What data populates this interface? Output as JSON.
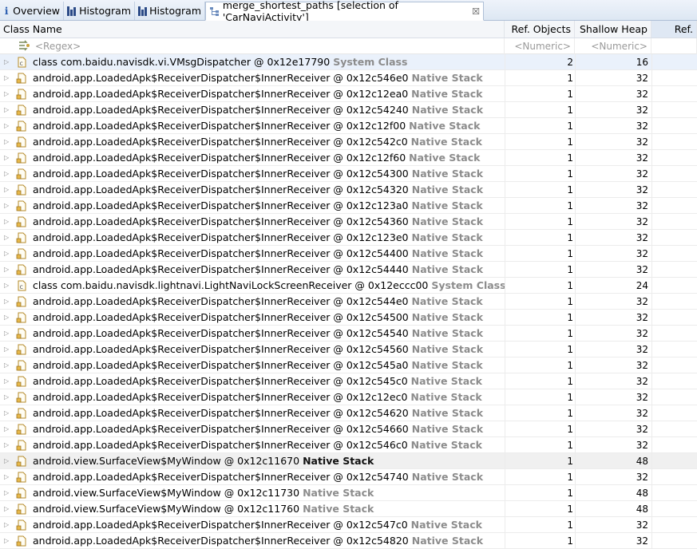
{
  "tabs": [
    {
      "label": "Overview",
      "icon": "info-icon"
    },
    {
      "label": "Histogram",
      "icon": "histogram-icon"
    },
    {
      "label": "Histogram",
      "icon": "histogram-icon"
    },
    {
      "label": "merge_shortest_paths [selection of 'CarNaviActivity']",
      "icon": "tree-icon",
      "active": true,
      "close": "☒"
    }
  ],
  "columns": {
    "class_name": "Class Name",
    "ref_objects": "Ref. Objects",
    "shallow_heap": "Shallow Heap",
    "ref_shallow": "Ref."
  },
  "filters": {
    "regex": "<Regex>",
    "numeric1": "<Numeric>",
    "numeric2": "<Numeric>"
  },
  "rows": [
    {
      "name": "class com.baidu.navisdk.vi.VMsgDispatcher @ 0x12e17790",
      "note": "System Class",
      "ref": "2",
      "shallow": "16",
      "type": "class"
    },
    {
      "name": "android.app.LoadedApk$ReceiverDispatcher$InnerReceiver @ 0x12c546e0",
      "note": "Native Stack",
      "ref": "1",
      "shallow": "32",
      "type": "obj"
    },
    {
      "name": "android.app.LoadedApk$ReceiverDispatcher$InnerReceiver @ 0x12c12ea0",
      "note": "Native Stack",
      "ref": "1",
      "shallow": "32",
      "type": "obj"
    },
    {
      "name": "android.app.LoadedApk$ReceiverDispatcher$InnerReceiver @ 0x12c54240",
      "note": "Native Stack",
      "ref": "1",
      "shallow": "32",
      "type": "obj"
    },
    {
      "name": "android.app.LoadedApk$ReceiverDispatcher$InnerReceiver @ 0x12c12f00",
      "note": "Native Stack",
      "ref": "1",
      "shallow": "32",
      "type": "obj"
    },
    {
      "name": "android.app.LoadedApk$ReceiverDispatcher$InnerReceiver @ 0x12c542c0",
      "note": "Native Stack",
      "ref": "1",
      "shallow": "32",
      "type": "obj"
    },
    {
      "name": "android.app.LoadedApk$ReceiverDispatcher$InnerReceiver @ 0x12c12f60",
      "note": "Native Stack",
      "ref": "1",
      "shallow": "32",
      "type": "obj"
    },
    {
      "name": "android.app.LoadedApk$ReceiverDispatcher$InnerReceiver @ 0x12c54300",
      "note": "Native Stack",
      "ref": "1",
      "shallow": "32",
      "type": "obj"
    },
    {
      "name": "android.app.LoadedApk$ReceiverDispatcher$InnerReceiver @ 0x12c54320",
      "note": "Native Stack",
      "ref": "1",
      "shallow": "32",
      "type": "obj"
    },
    {
      "name": "android.app.LoadedApk$ReceiverDispatcher$InnerReceiver @ 0x12c123a0",
      "note": "Native Stack",
      "ref": "1",
      "shallow": "32",
      "type": "obj"
    },
    {
      "name": "android.app.LoadedApk$ReceiverDispatcher$InnerReceiver @ 0x12c54360",
      "note": "Native Stack",
      "ref": "1",
      "shallow": "32",
      "type": "obj"
    },
    {
      "name": "android.app.LoadedApk$ReceiverDispatcher$InnerReceiver @ 0x12c123e0",
      "note": "Native Stack",
      "ref": "1",
      "shallow": "32",
      "type": "obj"
    },
    {
      "name": "android.app.LoadedApk$ReceiverDispatcher$InnerReceiver @ 0x12c54400",
      "note": "Native Stack",
      "ref": "1",
      "shallow": "32",
      "type": "obj"
    },
    {
      "name": "android.app.LoadedApk$ReceiverDispatcher$InnerReceiver @ 0x12c54440",
      "note": "Native Stack",
      "ref": "1",
      "shallow": "32",
      "type": "obj"
    },
    {
      "name": "class com.baidu.navisdk.lightnavi.LightNaviLockScreenReceiver @ 0x12eccc00",
      "note": "System Class",
      "ref": "1",
      "shallow": "24",
      "type": "class"
    },
    {
      "name": "android.app.LoadedApk$ReceiverDispatcher$InnerReceiver @ 0x12c544e0",
      "note": "Native Stack",
      "ref": "1",
      "shallow": "32",
      "type": "obj"
    },
    {
      "name": "android.app.LoadedApk$ReceiverDispatcher$InnerReceiver @ 0x12c54500",
      "note": "Native Stack",
      "ref": "1",
      "shallow": "32",
      "type": "obj"
    },
    {
      "name": "android.app.LoadedApk$ReceiverDispatcher$InnerReceiver @ 0x12c54540",
      "note": "Native Stack",
      "ref": "1",
      "shallow": "32",
      "type": "obj"
    },
    {
      "name": "android.app.LoadedApk$ReceiverDispatcher$InnerReceiver @ 0x12c54560",
      "note": "Native Stack",
      "ref": "1",
      "shallow": "32",
      "type": "obj"
    },
    {
      "name": "android.app.LoadedApk$ReceiverDispatcher$InnerReceiver @ 0x12c545a0",
      "note": "Native Stack",
      "ref": "1",
      "shallow": "32",
      "type": "obj"
    },
    {
      "name": "android.app.LoadedApk$ReceiverDispatcher$InnerReceiver @ 0x12c545c0",
      "note": "Native Stack",
      "ref": "1",
      "shallow": "32",
      "type": "obj"
    },
    {
      "name": "android.app.LoadedApk$ReceiverDispatcher$InnerReceiver @ 0x12c12ec0",
      "note": "Native Stack",
      "ref": "1",
      "shallow": "32",
      "type": "obj"
    },
    {
      "name": "android.app.LoadedApk$ReceiverDispatcher$InnerReceiver @ 0x12c54620",
      "note": "Native Stack",
      "ref": "1",
      "shallow": "32",
      "type": "obj"
    },
    {
      "name": "android.app.LoadedApk$ReceiverDispatcher$InnerReceiver @ 0x12c54660",
      "note": "Native Stack",
      "ref": "1",
      "shallow": "32",
      "type": "obj"
    },
    {
      "name": "android.app.LoadedApk$ReceiverDispatcher$InnerReceiver @ 0x12c546c0",
      "note": "Native Stack",
      "ref": "1",
      "shallow": "32",
      "type": "obj"
    },
    {
      "name": "android.view.SurfaceView$MyWindow @ 0x12c11670",
      "note": "Native Stack",
      "ref": "1",
      "shallow": "48",
      "type": "obj",
      "strong": true
    },
    {
      "name": "android.app.LoadedApk$ReceiverDispatcher$InnerReceiver @ 0x12c54740",
      "note": "Native Stack",
      "ref": "1",
      "shallow": "32",
      "type": "obj"
    },
    {
      "name": "android.view.SurfaceView$MyWindow @ 0x12c11730",
      "note": "Native Stack",
      "ref": "1",
      "shallow": "48",
      "type": "obj"
    },
    {
      "name": "android.view.SurfaceView$MyWindow @ 0x12c11760",
      "note": "Native Stack",
      "ref": "1",
      "shallow": "48",
      "type": "obj"
    },
    {
      "name": "android.app.LoadedApk$ReceiverDispatcher$InnerReceiver @ 0x12c547c0",
      "note": "Native Stack",
      "ref": "1",
      "shallow": "32",
      "type": "obj"
    },
    {
      "name": "android.app.LoadedApk$ReceiverDispatcher$InnerReceiver @ 0x12c54820",
      "note": "Native Stack",
      "ref": "1",
      "shallow": "32",
      "type": "obj"
    }
  ]
}
